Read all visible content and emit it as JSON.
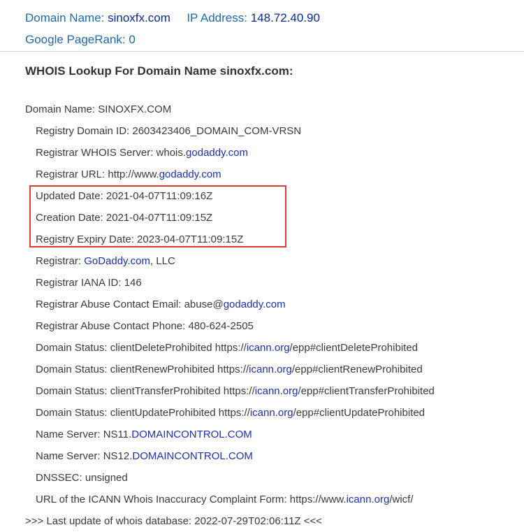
{
  "header": {
    "domain_label": "Domain Name:",
    "domain_value": "sinoxfx.com",
    "ip_label": "IP Address:",
    "ip_value": "148.72.40.90",
    "pagerank_label": "Google PageRank:",
    "pagerank_value": "0"
  },
  "heading": "WHOIS Lookup For Domain Name sinoxfx.com:",
  "whois": {
    "domain_name": "Domain Name: SINOXFX.COM",
    "registry_domain_id": "Registry Domain ID: 2603423406_DOMAIN_COM-VRSN",
    "registrar_whois_prefix": "Registrar WHOIS Server: whois.",
    "registrar_whois_link": "godaddy.com",
    "registrar_url_prefix": "Registrar URL: http://www.",
    "registrar_url_link": "godaddy.com",
    "updated_date": "Updated Date: 2021-04-07T11:09:16Z",
    "creation_date": "Creation Date: 2021-04-07T11:09:15Z",
    "expiry_date": "Registry Expiry Date: 2023-04-07T11:09:15Z",
    "registrar_prefix": "Registrar: ",
    "registrar_link": "GoDaddy.com",
    "registrar_suffix": ", LLC",
    "iana_id": "Registrar IANA ID: 146",
    "abuse_email_prefix": "Registrar Abuse Contact Email: abuse@",
    "abuse_email_link": "godaddy.com",
    "abuse_phone": "Registrar Abuse Contact Phone: 480-624-2505",
    "status": [
      {
        "prefix": "Domain Status: clientDeleteProhibited https://",
        "link": "icann.org",
        "suffix": "/epp#clientDeleteProhibited"
      },
      {
        "prefix": "Domain Status: clientRenewProhibited https://",
        "link": "icann.org",
        "suffix": "/epp#clientRenewProhibited"
      },
      {
        "prefix": "Domain Status: clientTransferProhibited https://",
        "link": "icann.org",
        "suffix": "/epp#clientTransferProhibited"
      },
      {
        "prefix": "Domain Status: clientUpdateProhibited https://",
        "link": "icann.org",
        "suffix": "/epp#clientUpdateProhibited"
      }
    ],
    "ns": [
      {
        "prefix": "Name Server: NS11.",
        "link": "DOMAINCONTROL.COM"
      },
      {
        "prefix": "Name Server: NS12.",
        "link": "DOMAINCONTROL.COM"
      }
    ],
    "dnssec": "DNSSEC: unsigned",
    "icann_form_prefix": "URL of the ICANN Whois Inaccuracy Complaint Form: https://www.",
    "icann_form_link": "icann.org",
    "icann_form_suffix": "/wicf/",
    "last_update": ">>> Last update of whois database: 2022-07-29T02:06:11Z <<<"
  },
  "colors": {
    "link": "#1c2fb8",
    "header_label": "#1a6bb0",
    "highlight_box": "#e53935"
  }
}
